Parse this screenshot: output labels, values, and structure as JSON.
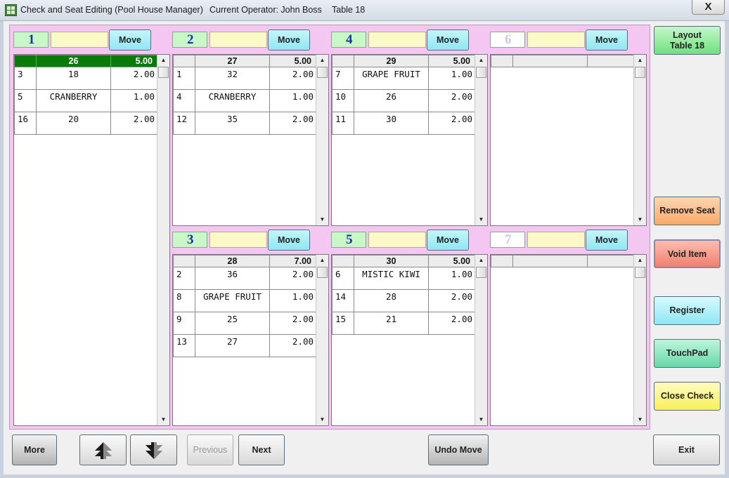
{
  "window": {
    "title": "Check and Seat Editing (Pool House Manager)",
    "operator": "Current Operator: John Boss",
    "table": "Table 18",
    "close_glyph": "X"
  },
  "seats": [
    {
      "number": "1",
      "move_label": "Move",
      "header": [
        "",
        "26",
        "5.00"
      ],
      "header_selected": true,
      "rows": [
        [
          "3",
          "18",
          "2.00"
        ],
        [
          "5",
          "CRANBERRY",
          "1.00"
        ],
        [
          "16",
          "20",
          "2.00"
        ]
      ]
    },
    {
      "number": "2",
      "move_label": "Move",
      "header": [
        "",
        "27",
        "5.00"
      ],
      "header_selected": false,
      "rows": [
        [
          "1",
          "32",
          "2.00"
        ],
        [
          "4",
          "CRANBERRY",
          "1.00"
        ],
        [
          "12",
          "35",
          "2.00"
        ]
      ]
    },
    {
      "number": "4",
      "move_label": "Move",
      "header": [
        "",
        "29",
        "5.00"
      ],
      "header_selected": false,
      "rows": [
        [
          "7",
          "GRAPE FRUIT",
          "1.00"
        ],
        [
          "10",
          "26",
          "2.00"
        ],
        [
          "11",
          "30",
          "2.00"
        ]
      ]
    },
    {
      "number": "6",
      "move_label": "Move",
      "empty": true,
      "header": [
        "",
        "",
        ""
      ],
      "header_selected": false,
      "rows": []
    },
    {
      "number": "3",
      "move_label": "Move",
      "header": [
        "",
        "28",
        "7.00"
      ],
      "header_selected": false,
      "rows": [
        [
          "2",
          "36",
          "2.00"
        ],
        [
          "8",
          "GRAPE FRUIT",
          "1.00"
        ],
        [
          "9",
          "25",
          "2.00"
        ],
        [
          "13",
          "27",
          "2.00"
        ]
      ]
    },
    {
      "number": "5",
      "move_label": "Move",
      "header": [
        "",
        "30",
        "5.00"
      ],
      "header_selected": false,
      "rows": [
        [
          "6",
          "MISTIC KIWI",
          "1.00"
        ],
        [
          "14",
          "28",
          "2.00"
        ],
        [
          "15",
          "21",
          "2.00"
        ]
      ]
    },
    {
      "number": "7",
      "move_label": "Move",
      "empty": true,
      "header": [
        "",
        "",
        ""
      ],
      "header_selected": false,
      "rows": []
    }
  ],
  "side_buttons": {
    "layout": [
      "Layout",
      "Table 18"
    ],
    "remove_seat": "Remove Seat",
    "void_item": "Void Item",
    "register": "Register",
    "touchpad": "TouchPad",
    "close_check": "Close Check",
    "exit": "Exit"
  },
  "bottom_buttons": {
    "more": "More",
    "previous": "Previous",
    "next": "Next",
    "undo_move": "Undo Move",
    "up_icon": "up-arrow-icon",
    "down_icon": "down-arrow-icon"
  },
  "colors": {
    "panel": "#f4c6f2",
    "selected_header": "#0a7a0a",
    "seat_number_text": "#1b2fa8",
    "move_button": "#8fe6f3"
  }
}
